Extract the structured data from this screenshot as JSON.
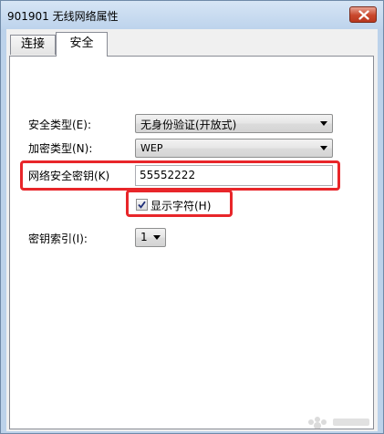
{
  "window": {
    "title": "901901 无线网络属性"
  },
  "tabs": [
    {
      "label": "连接"
    },
    {
      "label": "安全"
    }
  ],
  "security": {
    "security_type_label": "安全类型(E):",
    "security_type_value": "无身份验证(开放式)",
    "encryption_type_label": "加密类型(N):",
    "encryption_type_value": "WEP",
    "network_key_label": "网络安全密钥(K)",
    "network_key_value": "55552222",
    "show_characters_label": "显示字符(H)",
    "show_characters_checked": true,
    "key_index_label": "密钥索引(I):",
    "key_index_value": "1"
  },
  "colors": {
    "highlight": "#e8262a",
    "close_button": "#c9472c"
  }
}
